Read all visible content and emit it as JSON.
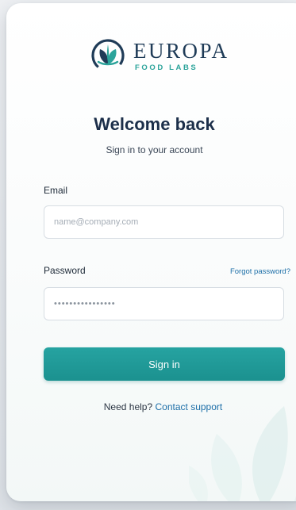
{
  "brand": {
    "name": "EUROPA",
    "tagline": "FOOD LABS",
    "logo_icon": "leaf-globe-icon",
    "colors": {
      "navy": "#1f3b57",
      "teal": "#2ba39a"
    }
  },
  "header": {
    "title": "Welcome back",
    "subtitle": "Sign in to your account"
  },
  "form": {
    "email_label": "Email",
    "email_placeholder": "name@company.com",
    "email_value": "",
    "password_label": "Password",
    "password_value": "••••••••••••••••",
    "forgot_password": "Forgot password?",
    "submit_label": "Sign in"
  },
  "footer": {
    "help_text": "Need help?",
    "contact_link": "Contact support"
  },
  "theme": {
    "accent": "#1f9b99",
    "link": "#1d6fa8"
  }
}
